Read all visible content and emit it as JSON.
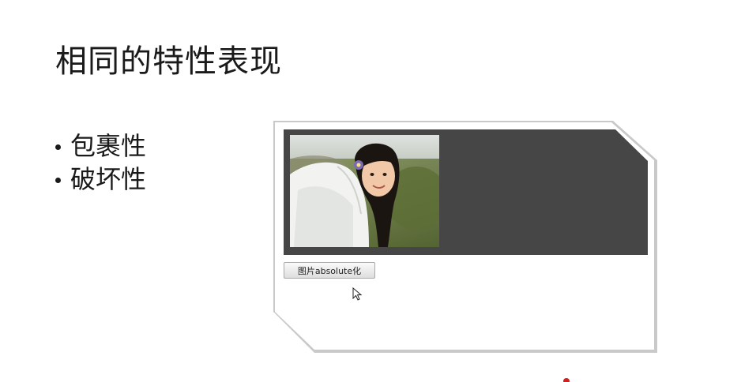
{
  "slide": {
    "title": "相同的特性表现",
    "bullets": [
      {
        "text": "包裹性"
      },
      {
        "text": "破坏性"
      }
    ]
  },
  "demo": {
    "button_label": "图片absolute化",
    "photo_alt": "demo photo",
    "colors": {
      "dark_box": "#464646",
      "card_border": "#c9c9c9"
    }
  },
  "icons": {
    "cursor": "mouse-pointer-icon",
    "bullet": "bullet-dot-icon"
  }
}
